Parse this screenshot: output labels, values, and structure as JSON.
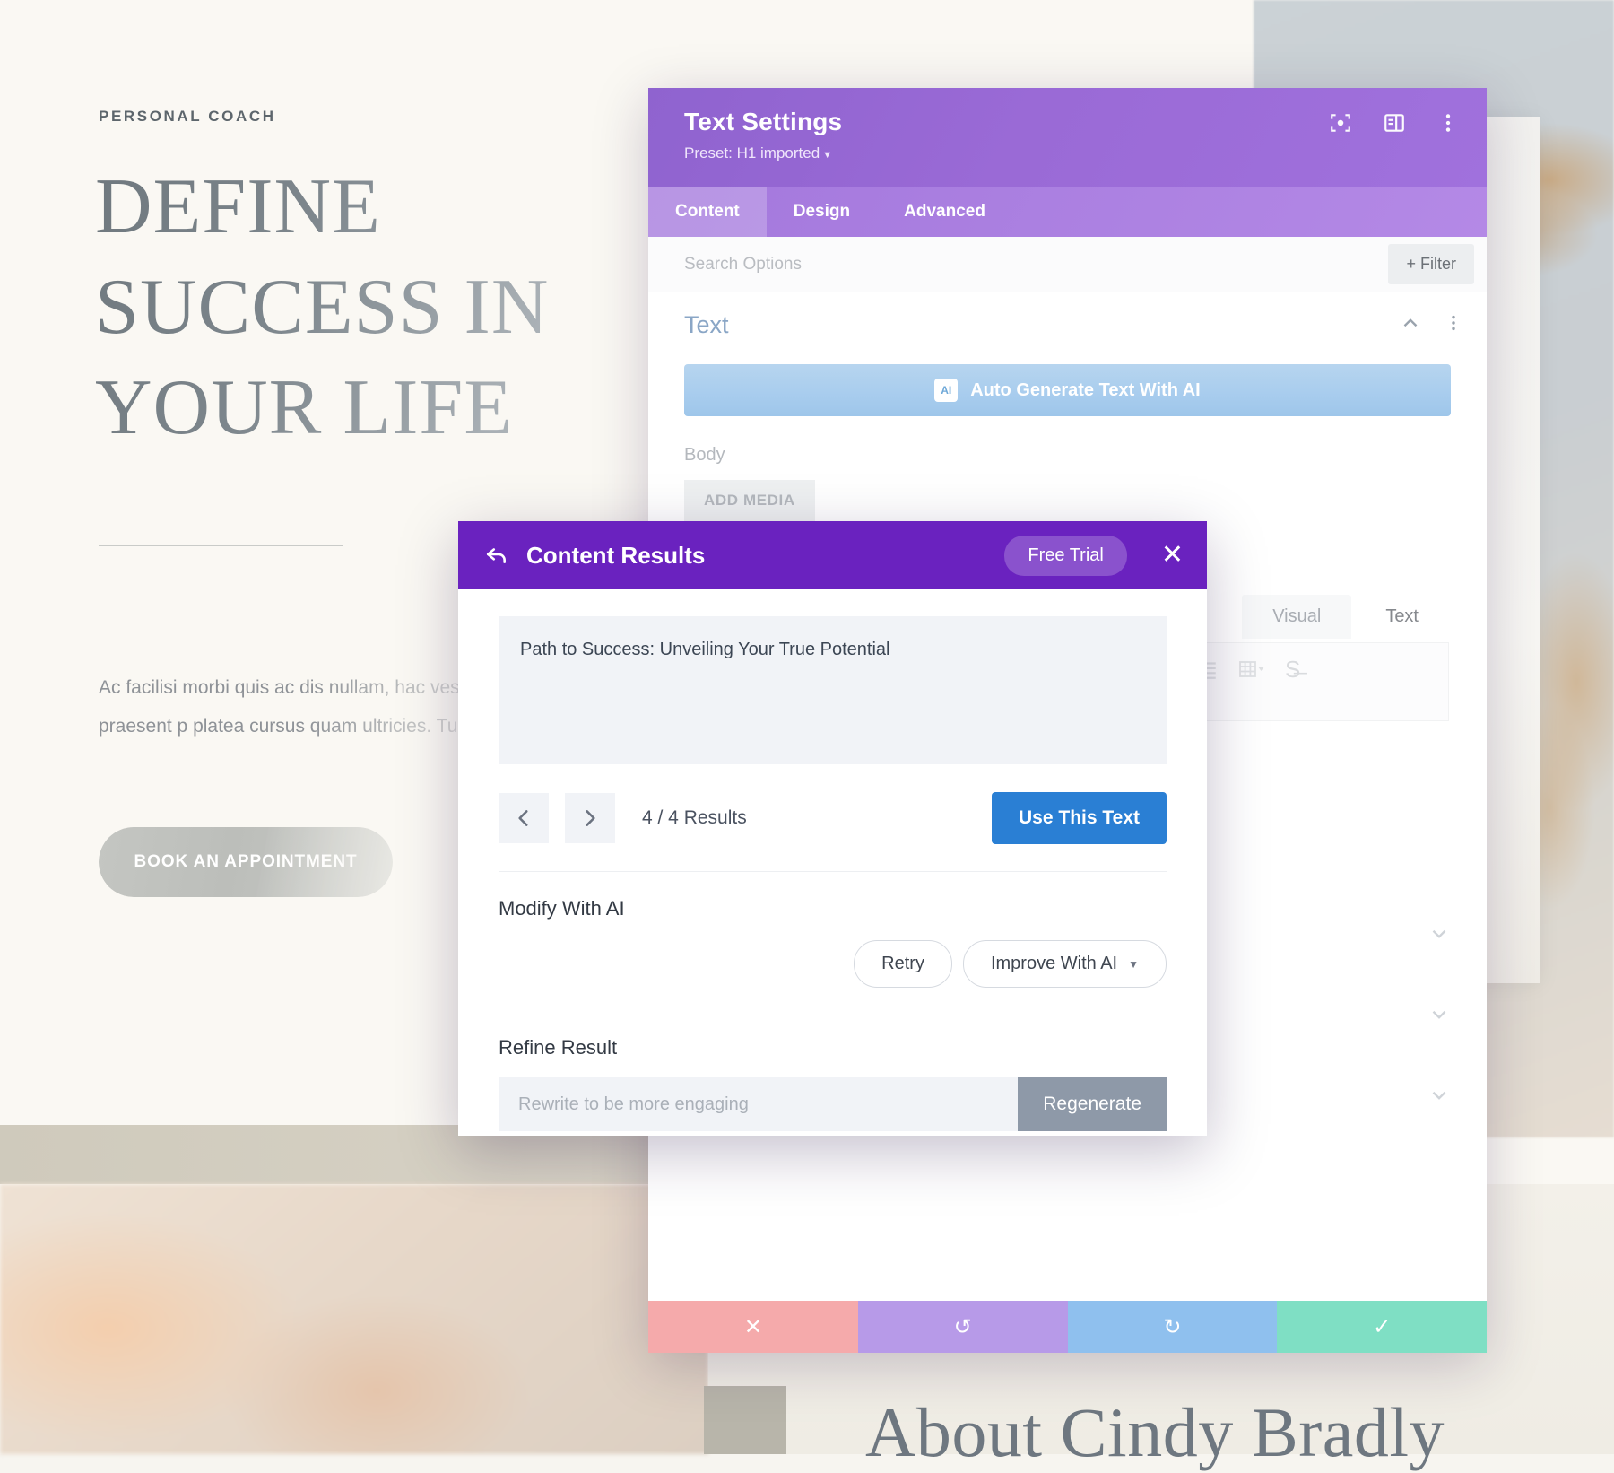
{
  "website": {
    "eyebrow": "PERSONAL COACH",
    "title": "DEFINE SUCCESS IN YOUR LIFE",
    "body": "Ac facilisi morbi quis ac dis nullam, hac vestibulum. Luctus praesent p platea cursus quam ultricies. Tu",
    "cta_label": "BOOK AN APPOINTMENT",
    "faint_word": "Life",
    "about_title": "About Cindy Bradly"
  },
  "settings_panel": {
    "title": "Text Settings",
    "preset": "Preset: H1 imported",
    "header_icons": [
      "focus-target-icon",
      "layout-panel-icon",
      "vertical-dots-icon"
    ],
    "tabs": [
      {
        "label": "Content",
        "active": true
      },
      {
        "label": "Design",
        "active": false
      },
      {
        "label": "Advanced",
        "active": false
      }
    ],
    "search_placeholder": "Search Options",
    "search_value": "",
    "filter_label": "Filter",
    "section": {
      "name": "Text",
      "collapse_icon": "chevron-up-icon",
      "more_icon": "vertical-dots-icon"
    },
    "ai_button_label": "Auto Generate Text With AI",
    "ai_badge_label": "AI",
    "body_field_label": "Body",
    "add_media_label": "ADD MEDIA",
    "editor_tabs": [
      {
        "label": "Visual",
        "active": false
      },
      {
        "label": "Text",
        "active": true
      }
    ],
    "toolbar_icons": [
      "align-right-icon",
      "align-justify-icon",
      "table-dropdown-icon",
      "strikethrough-icon",
      "broken-image-icon"
    ],
    "collapsed_sections": 3,
    "footer_buttons": [
      {
        "name": "cancel-button",
        "icon": "close-icon",
        "glyph": "✕",
        "color": "#f5aaab"
      },
      {
        "name": "undo-button",
        "icon": "undo-icon",
        "glyph": "↺",
        "color": "#b79ae8"
      },
      {
        "name": "redo-button",
        "icon": "redo-icon",
        "glyph": "↻",
        "color": "#8fc0ee"
      },
      {
        "name": "save-button",
        "icon": "check-icon",
        "glyph": "✓",
        "color": "#7fdfc4"
      }
    ]
  },
  "content_results": {
    "title": "Content Results",
    "back_icon": "back-arrow-icon",
    "trial_label": "Free Trial",
    "close_label": "✕",
    "result_text": "Path to Success: Unveiling Your True Potential",
    "prev_label": "‹",
    "next_label": "›",
    "results_count": "4 / 4 Results",
    "use_text_label": "Use This Text",
    "modify_label": "Modify With AI",
    "retry_label": "Retry",
    "improve_label": "Improve With AI",
    "refine_label": "Refine Result",
    "refine_placeholder": "Rewrite to be more engaging",
    "refine_value": "",
    "regenerate_label": "Regenerate"
  },
  "colors": {
    "panel_header_purple": "#9a6ad6",
    "modal_header_purple": "#6a22bf",
    "use_text_blue": "#2a7fd4",
    "ai_button_blue": "#a9cdee"
  }
}
